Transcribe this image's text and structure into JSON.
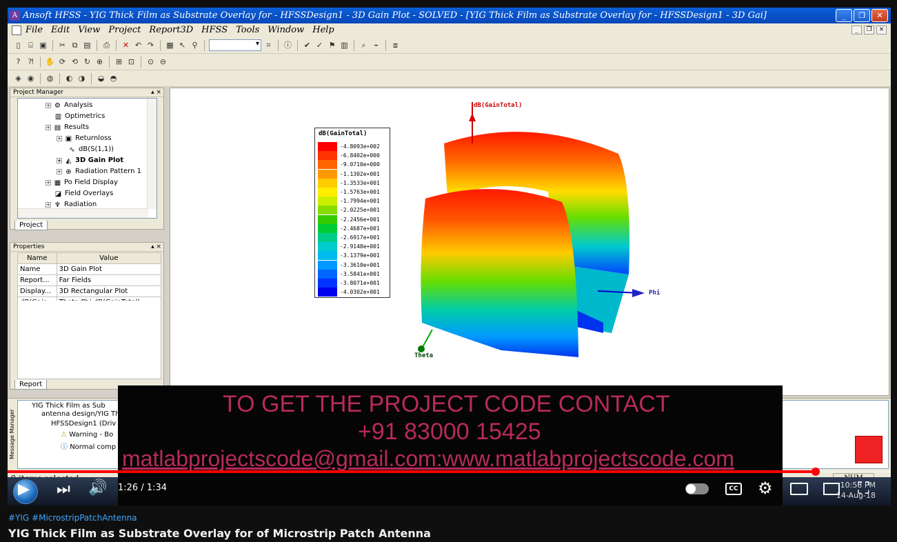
{
  "window": {
    "title": "Ansoft HFSS  - YIG Thick Film as Substrate Overlay for  - HFSSDesign1 - 3D Gain Plot - SOLVED - [YIG Thick Film as Substrate Overlay for - HFSSDesign1 - 3D Gai]",
    "minimize": "_",
    "maximize": "❐",
    "close": "✕"
  },
  "menu": [
    "File",
    "Edit",
    "View",
    "Project",
    "Report3D",
    "HFSS",
    "Tools",
    "Window",
    "Help"
  ],
  "project_manager": {
    "title": "Project Manager",
    "tree": [
      {
        "label": "Analysis",
        "icon": "analysis-icon",
        "bold": false
      },
      {
        "label": "Optimetrics",
        "icon": "optimetrics-icon",
        "bold": false
      },
      {
        "label": "Results",
        "icon": "results-icon",
        "bold": false
      },
      {
        "label": "Returnloss",
        "icon": "report-icon",
        "bold": false
      },
      {
        "label": "dB(S(1,1))",
        "icon": "trace-icon",
        "bold": false
      },
      {
        "label": "3D Gain Plot",
        "icon": "gain-plot-icon",
        "bold": true
      },
      {
        "label": "Radiation Pattern 1",
        "icon": "radiation-pattern-icon",
        "bold": false
      },
      {
        "label": "Po  Field Display",
        "icon": "field-display-icon",
        "bold": false
      },
      {
        "label": "Field Overlays",
        "icon": "field-overlays-icon",
        "bold": false
      },
      {
        "label": "Radiation",
        "icon": "radiation-icon",
        "bold": false
      }
    ],
    "tab": "Project"
  },
  "properties": {
    "title": "Properties",
    "columns": [
      "Name",
      "Value"
    ],
    "rows": [
      [
        "Name",
        "3D Gain Plot"
      ],
      [
        "Report...",
        "Far Fields"
      ],
      [
        "Display...",
        "3D Rectangular Plot"
      ],
      [
        "dB(Gain...",
        "Theta,Phi,dB(GainTotal)"
      ]
    ],
    "tab": "Report"
  },
  "plot": {
    "z_axis": "dB(GainTotal)",
    "x_axis": "Phi",
    "y_axis": "Theta",
    "legend_title": "dB(GainTotal)",
    "legend_values": [
      "-4.8093e+002",
      "-6.8402e+000",
      "-9.0710e+000",
      "-1.1302e+001",
      "-1.3533e+001",
      "-1.5763e+001",
      "-1.7994e+001",
      "-2.0225e+001",
      "-2.2456e+001",
      "-2.4687e+001",
      "-2.6917e+001",
      "-2.9148e+001",
      "-3.1379e+001",
      "-3.3610e+001",
      "-3.5841e+001",
      "-3.8071e+001",
      "-4.0302e+001"
    ],
    "legend_colors": [
      "#ff0000",
      "#ff3300",
      "#ff6600",
      "#ff9900",
      "#ffcc00",
      "#ffee00",
      "#ccee00",
      "#88dd00",
      "#33cc00",
      "#00cc33",
      "#00cc88",
      "#00cccc",
      "#00bbee",
      "#0099ff",
      "#0066ff",
      "#0033ff",
      "#0000ee"
    ]
  },
  "messages": {
    "side_label": "Message Manager",
    "items": [
      "YIG Thick Film as Sub",
      "antenna design/YIG Th",
      "HFSSDesign1 (Driv",
      "Warning - Bo",
      "Normal comp"
    ]
  },
  "status": {
    "text": "0 items selected.",
    "num": "NUM"
  },
  "overlay": {
    "line1": "TO GET THE PROJECT CODE CONTACT",
    "line2": "+91 83000 15425",
    "line3": "matlabprojectscode@gmail.com:www.matlabprojectscode.com"
  },
  "taskbar": {
    "time": "10:58 PM",
    "date": "14-Aug-18"
  },
  "player": {
    "time": "1:26 / 1:34",
    "progress": 0.915,
    "cc": "CC"
  },
  "video": {
    "hashtags": "#YIG #MicrostripPatchAntenna",
    "title": "YIG Thick Film as Substrate Overlay for of Microstrip Patch Antenna"
  }
}
